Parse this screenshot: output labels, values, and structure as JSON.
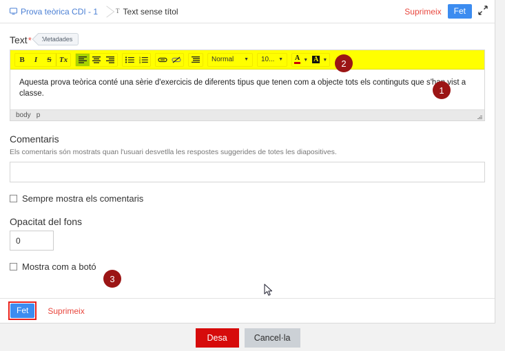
{
  "header": {
    "breadcrumb": [
      {
        "label": "Prova teòrica CDI - 1",
        "icon": "screen-icon"
      },
      {
        "label": "Text sense títol",
        "icon": "text-icon"
      }
    ],
    "delete_label": "Suprimeix",
    "done_label": "Fet",
    "expand_icon": "expand-arrows-icon"
  },
  "field": {
    "label": "Text",
    "required_marker": "*",
    "metadata_tab": "Metadades"
  },
  "toolbar": {
    "bold": "B",
    "italic": "I",
    "strikethrough": "S",
    "remove_format": "Tx",
    "align_left": "align-left-icon",
    "align_center": "align-center-icon",
    "align_right": "align-right-icon",
    "bulleted_list": "bulleted-list-icon",
    "numbered_list": "numbered-list-icon",
    "link": "link-icon",
    "unlink": "unlink-icon",
    "blockquote": "blockquote-icon",
    "paragraph_format": "Normal",
    "font_size": "10...",
    "text_color": "A",
    "background_color": "A"
  },
  "editor": {
    "content": "Aquesta prova teòrica conté una sèrie d'exercicis de diferents tipus que tenen com a objecte tots els continguts que s'han vist a classe.",
    "status_path_1": "body",
    "status_path_2": "p"
  },
  "comments": {
    "title": "Comentaris",
    "help": "Els comentaris són mostrats quan l'usuari desvetlla les respostes suggerides de totes les diapositives.",
    "value": "",
    "placeholder": "",
    "always_show_label": "Sempre mostra els comentaris",
    "always_show_checked": false
  },
  "background": {
    "opacity_label": "Opacitat del fons",
    "opacity_value": "0",
    "show_as_button_label": "Mostra com a botó",
    "show_as_button_checked": false
  },
  "panel_footer": {
    "done_label": "Fet",
    "delete_label": "Suprimeix"
  },
  "actions": {
    "save_label": "Desa",
    "cancel_label": "Cancel·la"
  },
  "markers": [
    {
      "number": "1"
    },
    {
      "number": "2"
    },
    {
      "number": "3"
    }
  ],
  "colors": {
    "accent_blue": "#3c8cf0",
    "danger_red": "#e8453c",
    "save_red": "#d60b0b",
    "highlight_yellow": "#ffff00",
    "badge_dark_red": "#9b1515",
    "active_green": "#a8d300"
  }
}
